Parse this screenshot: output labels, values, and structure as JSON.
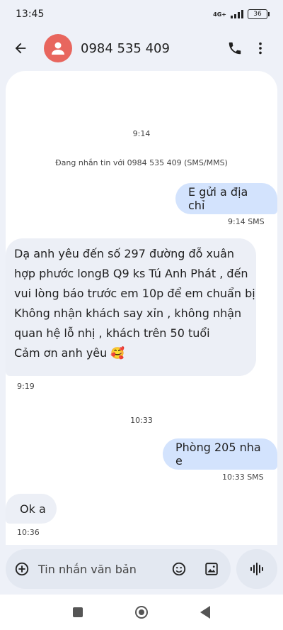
{
  "status_bar": {
    "time": "13:45",
    "network": "4G+",
    "battery": "36"
  },
  "header": {
    "contact": "0984 535 409",
    "icons": [
      "back-arrow-icon",
      "person-avatar-icon",
      "phone-icon",
      "more-vert-icon"
    ]
  },
  "conversation": {
    "time_1": "9:14",
    "info": "Đang nhắn tin với 0984 535 409 (SMS/MMS)",
    "outgoing_1": {
      "text": "E gửi a địa chỉ",
      "meta": "9:14  SMS"
    },
    "incoming_1": {
      "lines": [
        "Dạ anh yêu đến số 297 đường đỗ xuân",
        "hợp phước longB Q9 ks Tú Anh Phát , đến",
        "vui lòng báo trước em 10p để em chuẩn bị",
        "Không nhận khách say xỉn , không nhận",
        "quan hệ lỗ nhị , khách trên 50 tuổi",
        "Cảm ơn anh yêu 🥰"
      ],
      "time": "9:19"
    },
    "time_2": "10:33",
    "outgoing_2": {
      "text": "Phòng 205 nha e",
      "meta": "10:33  SMS"
    },
    "incoming_2": {
      "text": "Ok a",
      "time": "10:36"
    }
  },
  "composer": {
    "placeholder": "Tin nhắn văn bản",
    "icons": [
      "add-circle-icon",
      "emoji-icon",
      "gallery-icon",
      "voice-icon"
    ]
  },
  "colors": {
    "accent_bubble": "#d3e3fd",
    "incoming_bubble": "#eceff6",
    "avatar": "#e8665e"
  }
}
